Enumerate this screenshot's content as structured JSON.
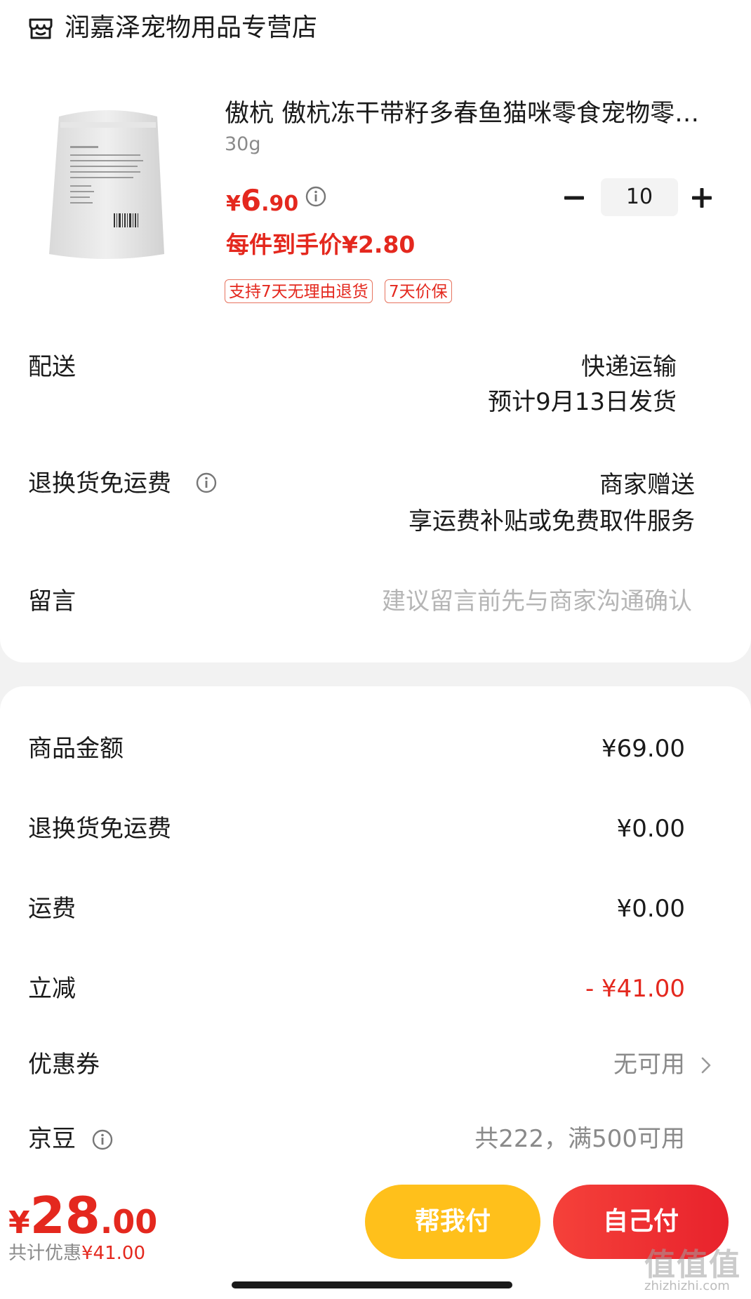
{
  "store": {
    "name": "润嘉泽宠物用品专营店",
    "icon": "store-icon"
  },
  "product": {
    "title": "傲杭 傲杭冻干带籽多春鱼猫咪零食宠物零…",
    "spec": "30g",
    "price_symbol": "¥",
    "price_int": "6",
    "price_dec": ".90",
    "per_unit": "每件到手价¥2.80",
    "tags": [
      "支持7天无理由退货",
      "7天价保"
    ],
    "quantity": "10"
  },
  "delivery": {
    "label": "配送",
    "method": "快递运输",
    "eta": "预计9月13日发货"
  },
  "return_free": {
    "label": "退换货免运费",
    "line1": "商家赠送",
    "line2": "享运费补贴或免费取件服务"
  },
  "message": {
    "label": "留言",
    "placeholder": "建议留言前先与商家沟通确认"
  },
  "summary": {
    "goods_amount": {
      "label": "商品金额",
      "value": "¥69.00"
    },
    "return_fee": {
      "label": "退换货免运费",
      "value": "¥0.00"
    },
    "shipping": {
      "label": "运费",
      "value": "¥0.00"
    },
    "discount": {
      "label": "立减",
      "value": "- ¥41.00"
    },
    "coupon": {
      "label": "优惠券",
      "value": "无可用"
    },
    "jingdou": {
      "label": "京豆",
      "value": "共222，满500可用"
    }
  },
  "footer": {
    "total_symbol": "¥",
    "total_int": "28",
    "total_dec": ".00",
    "saved_label": "共计优惠",
    "saved_value": "¥41.00",
    "help_pay": "帮我付",
    "self_pay": "自己付",
    "watermark": "值值值",
    "watermark_sub": "zhizhizhi.com"
  },
  "colors": {
    "accent_red": "#e4281e",
    "help_yellow": "#ffc01b",
    "pay_red": "#e8222c"
  }
}
